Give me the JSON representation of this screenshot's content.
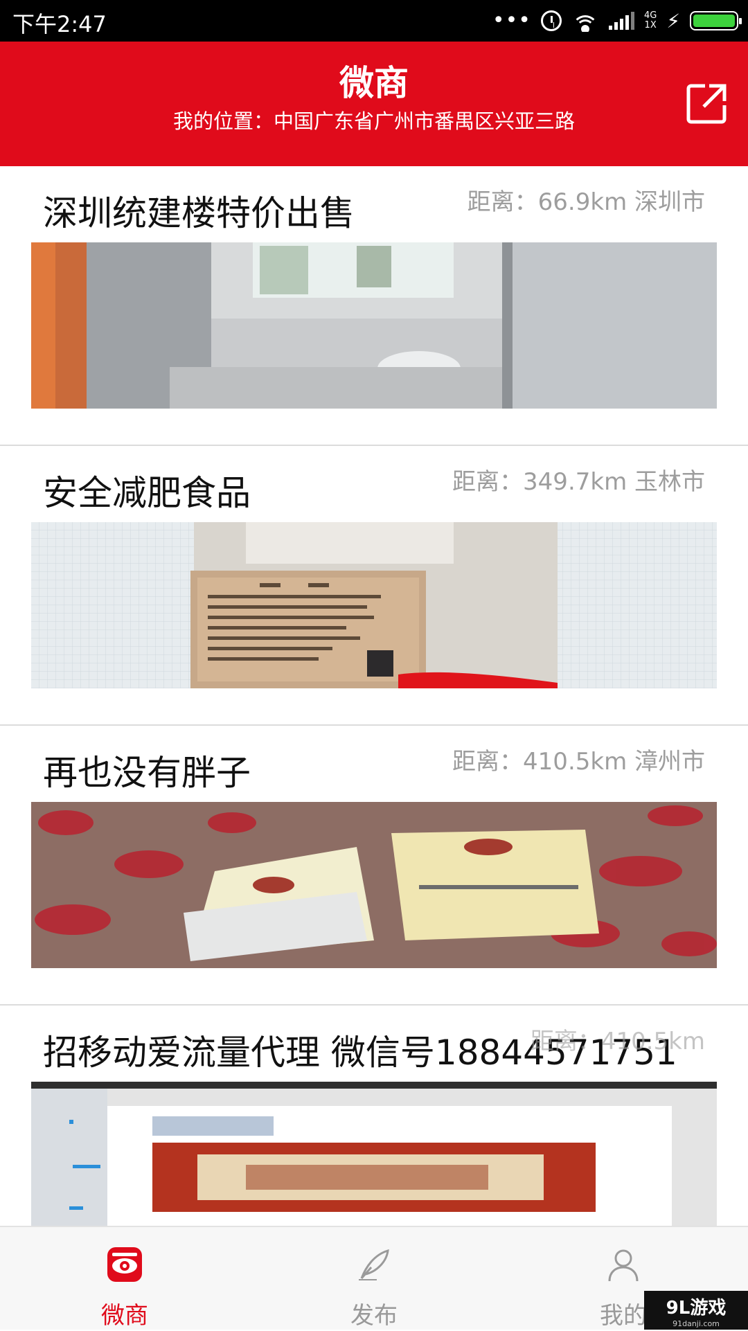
{
  "status_bar": {
    "time": "下午2:47",
    "dots": "•••",
    "network": "4G\n1X",
    "icons": [
      "alarm-icon",
      "wifi-icon",
      "signal-icon",
      "charging-icon",
      "battery-icon"
    ]
  },
  "header": {
    "title": "微商",
    "location": "我的位置：中国广东省广州市番禺区兴亚三路",
    "share_icon": "share-icon"
  },
  "listings": [
    {
      "title": "深圳统建楼特价出售",
      "distance": "距离：66.9km 深圳市"
    },
    {
      "title": "安全减肥食品",
      "distance": "距离：349.7km 玉林市"
    },
    {
      "title": "再也没有胖子",
      "distance": "距离：410.5km 漳州市"
    },
    {
      "title": "招移动爱流量代理  微信号18844571751",
      "distance": "距离：410.5km"
    }
  ],
  "tabs": [
    {
      "label": "微商",
      "icon": "eye-icon",
      "active": true
    },
    {
      "label": "发布",
      "icon": "feather-pen-icon",
      "active": false
    },
    {
      "label": "我的",
      "icon": "user-icon",
      "active": false
    }
  ],
  "watermark": {
    "brand": "9L游戏",
    "url": "91danji.com"
  },
  "colors": {
    "brand_red": "#e00b1b",
    "distance_gray": "#9d9d9d",
    "tab_inactive": "#999999"
  }
}
